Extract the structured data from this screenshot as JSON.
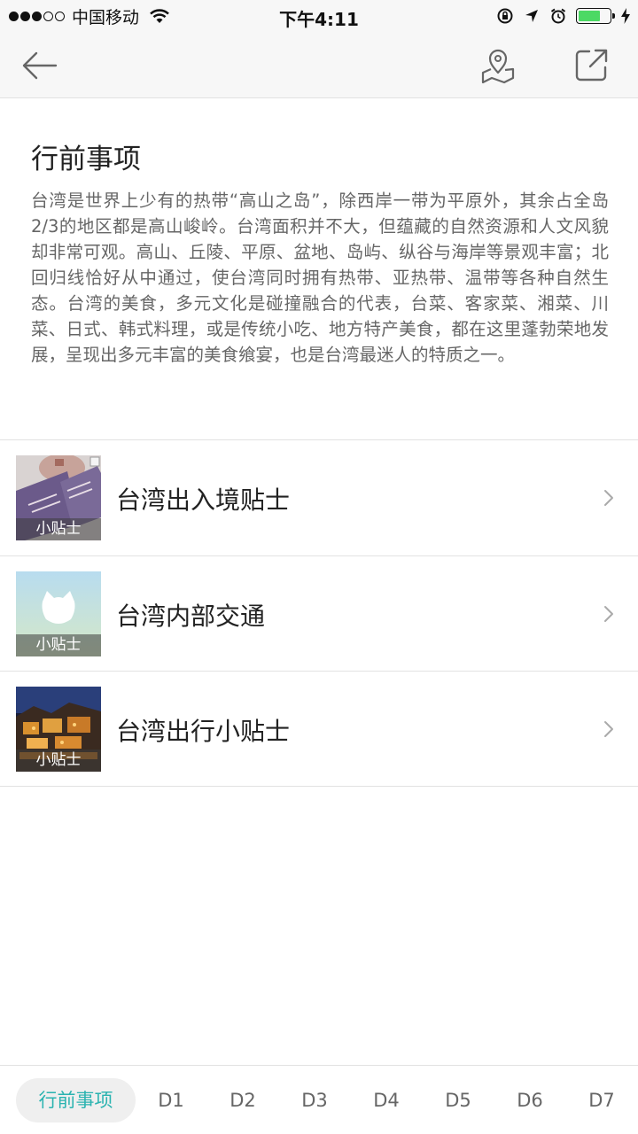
{
  "status_bar": {
    "carrier": "中国移动",
    "time": "下午4:11",
    "signal_filled": 3,
    "signal_total": 5,
    "battery_level": 0.7,
    "icons": [
      "wifi-icon",
      "rotation-lock-icon",
      "location-arrow-icon",
      "alarm-icon",
      "battery-icon",
      "charging-bolt-icon"
    ]
  },
  "nav": {
    "back_icon": "back-arrow-icon",
    "map_icon": "map-pin-icon",
    "share_icon": "share-icon"
  },
  "intro": {
    "title": "行前事项",
    "body": "台湾是世界上少有的热带“高山之岛”，除西岸一带为平原外，其余占全岛2/3的地区都是高山峻岭。台湾面积并不大，但蕴藏的自然资源和人文风貌却非常可观。高山、丘陵、平原、盆地、岛屿、纵谷与海岸等景观丰富；北回归线恰好从中通过，使台湾同时拥有热带、亚热带、温带等各种自然生态。台湾的美食，多元文化是碰撞融合的代表，台菜、客家菜、湘菜、川菜、日式、韩式料理，或是传统小吃、地方特产美食，都在这里蓬勃荣地发展，呈现出多元丰富的美食飨宴，也是台湾最迷人的特质之一。"
  },
  "tips": [
    {
      "title": "台湾出入境贴士",
      "badge": "小贴士"
    },
    {
      "title": "台湾内部交通",
      "badge": "小贴士"
    },
    {
      "title": "台湾出行小贴士",
      "badge": "小贴士"
    }
  ],
  "tabs": [
    "行前事项",
    "D1",
    "D2",
    "D3",
    "D4",
    "D5",
    "D6",
    "D7"
  ],
  "active_tab": "行前事项",
  "colors": {
    "accent": "#2ab3b0",
    "battery": "#4cd964"
  }
}
